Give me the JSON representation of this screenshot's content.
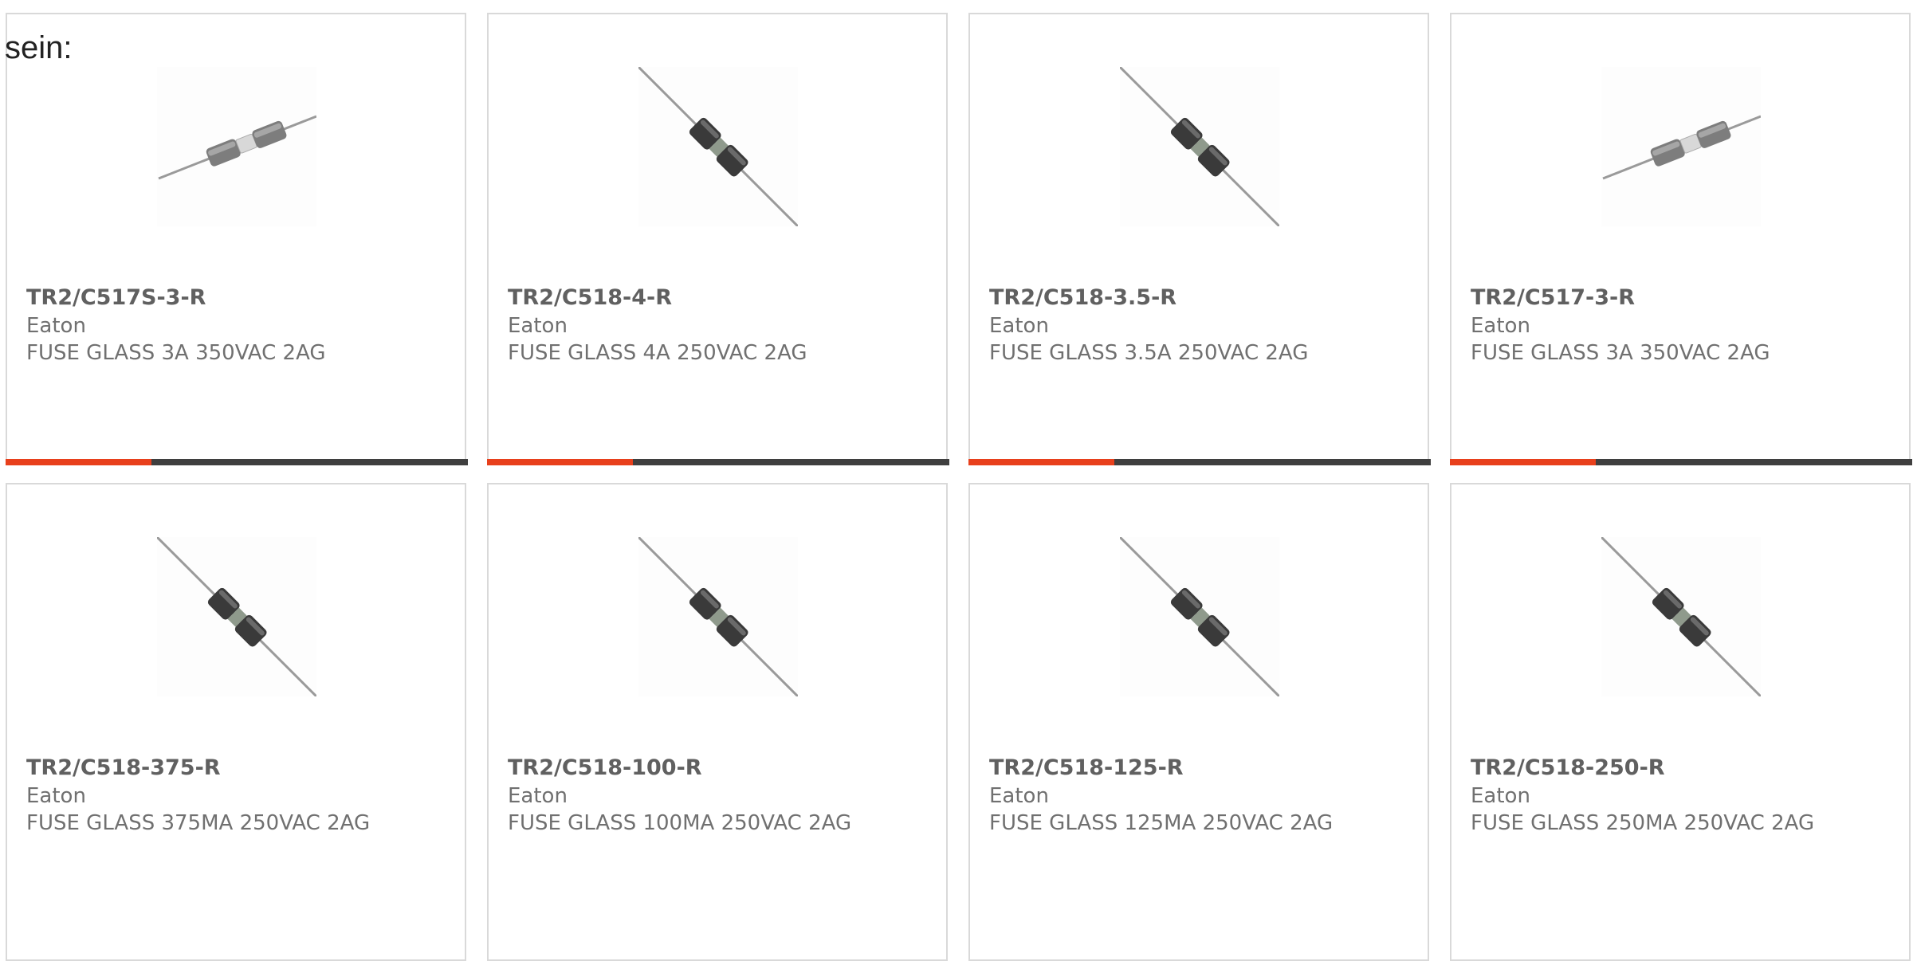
{
  "intro_text": "sein:",
  "colors": {
    "accent": "#e8401c",
    "bar": "#3f3f3f",
    "card_border": "#d9d9d9",
    "text": "#707070"
  },
  "products": [
    {
      "part_number": "TR2/C517S-3-R",
      "manufacturer": "Eaton",
      "description": "FUSE GLASS 3A 350VAC 2AG",
      "image_icon": "fuse-axial-shallow-icon"
    },
    {
      "part_number": "TR2/C518-4-R",
      "manufacturer": "Eaton",
      "description": "FUSE GLASS 4A 250VAC 2AG",
      "image_icon": "fuse-axial-diagonal-icon"
    },
    {
      "part_number": "TR2/C518-3.5-R",
      "manufacturer": "Eaton",
      "description": "FUSE GLASS 3.5A 250VAC 2AG",
      "image_icon": "fuse-axial-diagonal-icon"
    },
    {
      "part_number": "TR2/C517-3-R",
      "manufacturer": "Eaton",
      "description": "FUSE GLASS 3A 350VAC 2AG",
      "image_icon": "fuse-axial-shallow-icon"
    },
    {
      "part_number": "TR2/C518-375-R",
      "manufacturer": "Eaton",
      "description": "FUSE GLASS 375MA 250VAC 2AG",
      "image_icon": "fuse-axial-diagonal-icon"
    },
    {
      "part_number": "TR2/C518-100-R",
      "manufacturer": "Eaton",
      "description": "FUSE GLASS 100MA 250VAC 2AG",
      "image_icon": "fuse-axial-diagonal-icon"
    },
    {
      "part_number": "TR2/C518-125-R",
      "manufacturer": "Eaton",
      "description": "FUSE GLASS 125MA 250VAC 2AG",
      "image_icon": "fuse-axial-diagonal-icon"
    },
    {
      "part_number": "TR2/C518-250-R",
      "manufacturer": "Eaton",
      "description": "FUSE GLASS 250MA 250VAC 2AG",
      "image_icon": "fuse-axial-diagonal-icon"
    }
  ]
}
